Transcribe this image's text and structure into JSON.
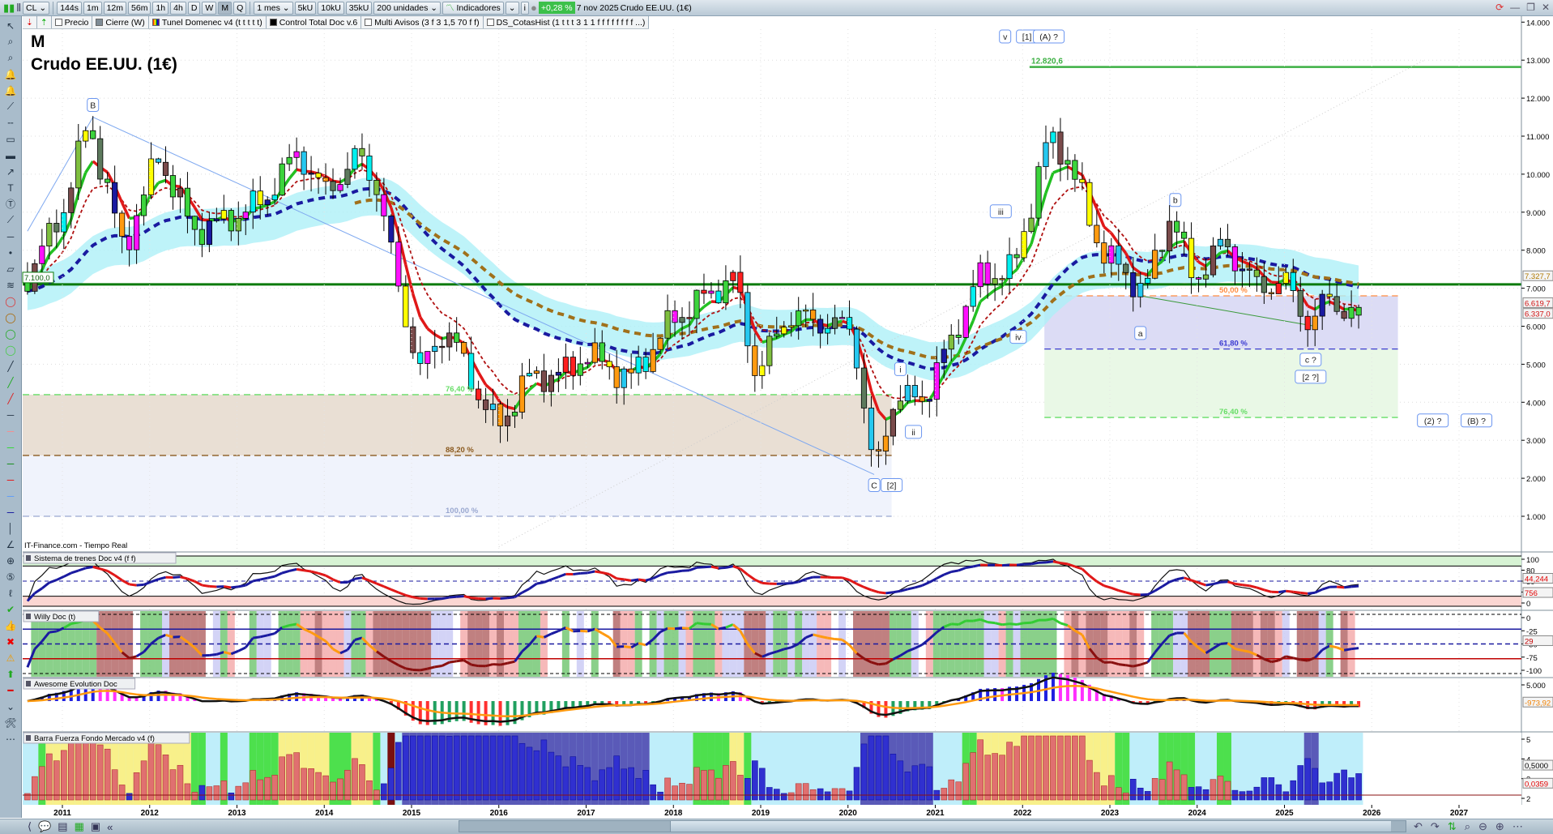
{
  "toolbar": {
    "symbol": "CL",
    "timeframes": [
      "144s",
      "1m",
      "12m",
      "56m",
      "1h",
      "4h",
      "D",
      "W",
      "M",
      "Q"
    ],
    "active_timeframe": "M",
    "period": "1 mes",
    "units": [
      "5kU",
      "10kU",
      "35kU"
    ],
    "count": "200 unidades",
    "indicators": "Indicadores",
    "change": "+0,28 %",
    "date": "7 nov 2025",
    "instrument": "Crudo EE.UU. (1€)"
  },
  "indicator_tabs": [
    "Precio",
    "Cierre (W)",
    "Tunel Domenec v4 (t t t t t)",
    "Control Total Doc v.6",
    "Multi Avisos (3 f 3 1,5 70 f f)",
    "DS_CotasHist (1 t t t 3 1 1 f f f f f f f f ...)"
  ],
  "chart": {
    "period_label": "M",
    "title": "Crudo EE.UU. (1€)",
    "source": "IT-Finance.com - Tiempo Real",
    "support_label": "7.100,0",
    "high_label": "12.820,6",
    "price_tags": [
      {
        "text": "7.327,7",
        "color": "#b07800",
        "value": 7327.7
      },
      {
        "text": "6.619,7",
        "color": "#d01010",
        "value": 6619.7
      },
      {
        "text": "6.337,0",
        "color": "#d01010",
        "value": 6337.0
      }
    ],
    "fib_left": [
      {
        "text": "76,40 %",
        "value": 4200,
        "color": "#66dd66"
      },
      {
        "text": "88,20 %",
        "value": 2600,
        "color": "#8a5a20"
      },
      {
        "text": "100,00 %",
        "value": 1000,
        "color": "#9aa8d0"
      }
    ],
    "fib_right": [
      {
        "text": "50,00 %",
        "value": 6800,
        "color": "#ff8c40"
      },
      {
        "text": "61,80 %",
        "value": 5400,
        "color": "#3a3ad0"
      },
      {
        "text": "76,40 %",
        "value": 3600,
        "color": "#66dd66"
      }
    ],
    "wave_labels": [
      {
        "text": "B",
        "t": 2011.35,
        "p": 11800
      },
      {
        "text": "v",
        "t": 2021.8,
        "p": 13600
      },
      {
        "text": "[1]",
        "t": 2022.05,
        "p": 13600
      },
      {
        "text": "(A) ?",
        "t": 2022.3,
        "p": 13600
      },
      {
        "text": "iii",
        "t": 2021.75,
        "p": 9000
      },
      {
        "text": "iv",
        "t": 2021.95,
        "p": 5700
      },
      {
        "text": "b",
        "t": 2023.75,
        "p": 9300
      },
      {
        "text": "a",
        "t": 2023.35,
        "p": 5800
      },
      {
        "text": "i",
        "t": 2020.6,
        "p": 4850
      },
      {
        "text": "ii",
        "t": 2020.75,
        "p": 3200
      },
      {
        "text": "C",
        "t": 2020.3,
        "p": 1800
      },
      {
        "text": "[2]",
        "t": 2020.5,
        "p": 1800
      },
      {
        "text": "c ?",
        "t": 2025.3,
        "p": 5100
      },
      {
        "text": "[2 ?]",
        "t": 2025.3,
        "p": 4650
      },
      {
        "text": "(2) ?",
        "t": 2026.7,
        "p": 3500
      },
      {
        "text": "(B) ?",
        "t": 2027.2,
        "p": 3500
      }
    ]
  },
  "panels": [
    {
      "title": "Sistema de trenes Doc v4 (f f)",
      "axis": [
        "100",
        "80",
        "50",
        "20",
        "0"
      ],
      "tags": [
        {
          "text": "44,244",
          "color": "#e00000"
        },
        {
          "text": "756",
          "color": "#e00000"
        }
      ]
    },
    {
      "title": "Willy Doc (t)",
      "axis": [
        "0",
        "-25",
        "-50",
        "-75",
        "-100"
      ],
      "tags": [
        {
          "text": "29",
          "color": "#c00000"
        }
      ]
    },
    {
      "title": "Awesome Evolution Doc",
      "axis": [
        "5.000"
      ],
      "tags": [
        {
          "text": "-973,92",
          "color": "#f08000"
        }
      ]
    },
    {
      "title": "Barra Fuerza Fondo Mercado v4 (f)",
      "axis": [
        "5",
        "4",
        "3",
        "2"
      ],
      "tags": [
        {
          "text": "0,5000",
          "color": "#000"
        },
        {
          "text": "0,0359",
          "color": "#e00000"
        }
      ]
    }
  ],
  "chart_data": {
    "type": "candlestick",
    "title": "Crudo EE.UU. (1€)",
    "xlabel": "",
    "ylabel": "",
    "ylim": [
      0,
      14000
    ],
    "xlim": [
      2010.55,
      2027.7
    ],
    "yticks": [
      "1.000",
      "2.000",
      "3.000",
      "4.000",
      "5.000",
      "6.000",
      "7.000",
      "8.000",
      "9.000",
      "10.000",
      "11.000",
      "12.000",
      "13.000",
      "14.000"
    ],
    "xticks": [
      "2011",
      "2012",
      "2013",
      "2014",
      "2015",
      "2016",
      "2017",
      "2018",
      "2019",
      "2020",
      "2021",
      "2022",
      "2023",
      "2024",
      "2025",
      "2026",
      "2027"
    ],
    "keypoints": [
      [
        2010.6,
        7300
      ],
      [
        2011.0,
        9000
      ],
      [
        2011.3,
        11400
      ],
      [
        2011.7,
        8000
      ],
      [
        2012.1,
        10500
      ],
      [
        2012.5,
        8500
      ],
      [
        2012.9,
        8800
      ],
      [
        2013.3,
        9300
      ],
      [
        2013.7,
        10600
      ],
      [
        2014.0,
        9500
      ],
      [
        2014.4,
        10500
      ],
      [
        2014.6,
        9700
      ],
      [
        2014.9,
        6500
      ],
      [
        2015.1,
        4800
      ],
      [
        2015.4,
        6000
      ],
      [
        2015.7,
        4500
      ],
      [
        2016.0,
        3300
      ],
      [
        2016.3,
        4600
      ],
      [
        2016.8,
        4800
      ],
      [
        2017.0,
        5300
      ],
      [
        2017.5,
        4600
      ],
      [
        2018.0,
        6200
      ],
      [
        2018.7,
        7300
      ],
      [
        2018.95,
        4700
      ],
      [
        2019.3,
        6300
      ],
      [
        2019.9,
        6000
      ],
      [
        2020.05,
        6000
      ],
      [
        2020.3,
        2000
      ],
      [
        2020.5,
        4000
      ],
      [
        2020.9,
        4200
      ],
      [
        2021.5,
        7300
      ],
      [
        2021.9,
        7500
      ],
      [
        2022.3,
        11000
      ],
      [
        2022.5,
        10500
      ],
      [
        2022.9,
        8000
      ],
      [
        2023.4,
        6900
      ],
      [
        2023.7,
        9000
      ],
      [
        2023.95,
        7200
      ],
      [
        2024.3,
        8200
      ],
      [
        2024.7,
        7000
      ],
      [
        2025.0,
        7200
      ],
      [
        2025.3,
        6000
      ],
      [
        2025.5,
        6800
      ],
      [
        2025.85,
        6100
      ]
    ],
    "support": 7100,
    "high": 12820.6
  }
}
